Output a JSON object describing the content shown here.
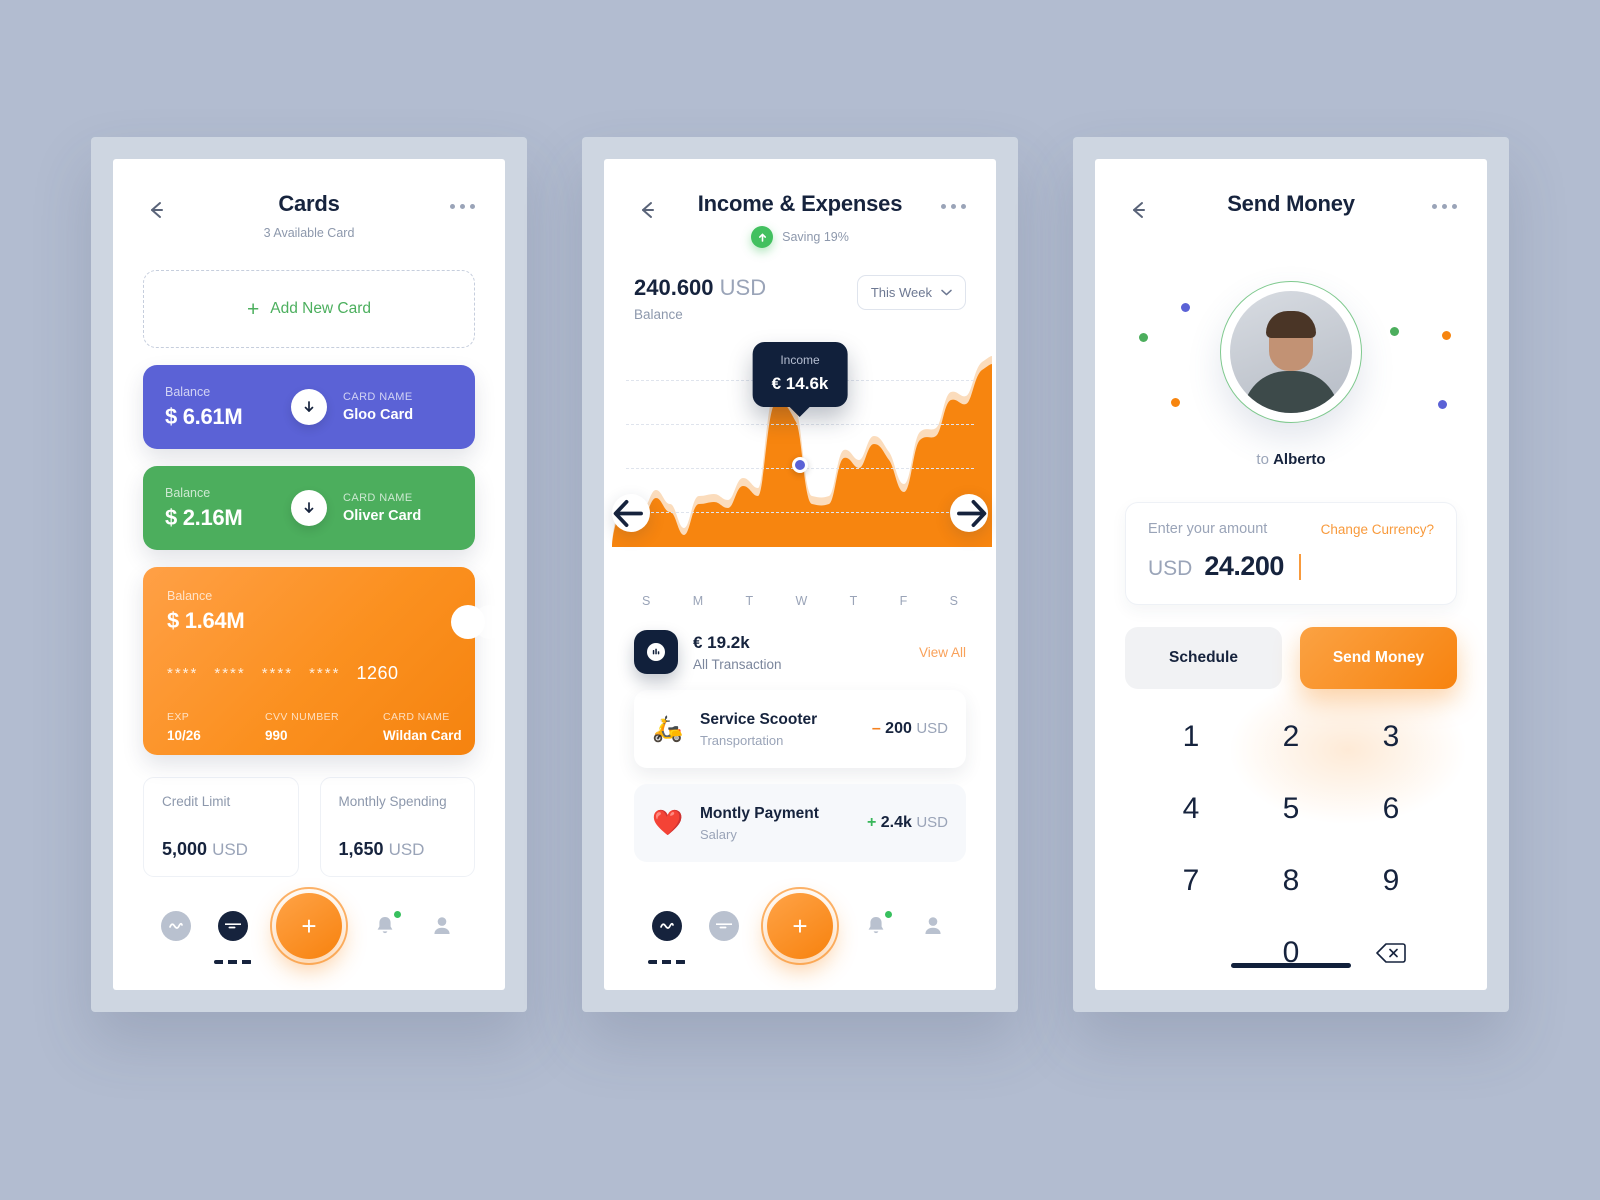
{
  "screens": {
    "cards": {
      "title": "Cards",
      "subtitle": "3 Available Card",
      "add_card_label": "Add New Card",
      "add_card_plus": "+",
      "card_list": [
        {
          "balance_label": "Balance",
          "balance": "$ 6.61M",
          "name_label": "CARD NAME",
          "name": "Gloo Card",
          "color": "#5b62d6"
        },
        {
          "balance_label": "Balance",
          "balance": "$ 2.16M",
          "name_label": "CARD NAME",
          "name": "Oliver Card",
          "color": "#4cae5d"
        }
      ],
      "featured_card": {
        "balance_label": "Balance",
        "balance": "$ 1.64M",
        "masked": [
          "****",
          "****",
          "****",
          "****"
        ],
        "last4": "1260",
        "exp_label": "EXP",
        "exp": "10/26",
        "cvv_label": "CVV NUMBER",
        "cvv": "990",
        "name_label": "CARD NAME",
        "name": "Wildan Card",
        "color": "#f7850f"
      },
      "stats": [
        {
          "title": "Credit Limit",
          "value": "5,000",
          "currency": "USD"
        },
        {
          "title": "Monthly Spending",
          "value": "1,650",
          "currency": "USD"
        }
      ]
    },
    "income": {
      "title": "Income & Expenses",
      "saving_text": "Saving 19%",
      "balance_value": "240.600",
      "balance_currency": "USD",
      "balance_caption": "Balance",
      "period": "This Week",
      "tooltip_label": "Income",
      "tooltip_value": "€ 14.6k",
      "transactions_total": "€ 19.2k",
      "transactions_caption": "All Transaction",
      "view_all": "View All",
      "rows": [
        {
          "emoji": "🛵",
          "name": "Service Scooter",
          "category": "Transportation",
          "sign": "–",
          "amount": "200",
          "currency": "USD",
          "direction": "neg"
        },
        {
          "emoji": "❤️",
          "name": "Montly Payment",
          "category": "Salary",
          "sign": "+",
          "amount": "2.4k",
          "currency": "USD",
          "direction": "pos"
        }
      ]
    },
    "send": {
      "title": "Send Money",
      "to_prefix": "to",
      "recipient": "Alberto",
      "amount_placeholder": "Enter your amount",
      "change_currency": "Change Currency?",
      "currency": "USD",
      "amount": "24.200",
      "schedule_label": "Schedule",
      "send_label": "Send Money",
      "keys": [
        "1",
        "2",
        "3",
        "4",
        "5",
        "6",
        "7",
        "8",
        "9",
        "",
        "0",
        "⌫"
      ]
    }
  },
  "chart_data": {
    "type": "area",
    "title": "Income & Expenses",
    "categories": [
      "S",
      "M",
      "T",
      "W",
      "T",
      "F",
      "S"
    ],
    "xlabel": "",
    "ylabel": "",
    "grid": true,
    "legend": false,
    "highlight": {
      "category": "T",
      "label": "Income",
      "value": "€ 14.6k",
      "numeric": 14600
    },
    "series": [
      {
        "name": "Income",
        "color": "#f7850f",
        "values": [
          0,
          4.2,
          6.1,
          5.4,
          6.5,
          3.0,
          5.1,
          5.6,
          5.2,
          7.0,
          6.2,
          14.6,
          13.0,
          5.9,
          5.2,
          8.4,
          9.2,
          8.0,
          6.3,
          9.0,
          11.5,
          12.2,
          13.4,
          16.8
        ]
      },
      {
        "name": "Expenses",
        "color": "#fbd9b6",
        "values": [
          0,
          4.9,
          6.9,
          6.2,
          7.2,
          3.7,
          5.9,
          6.4,
          6.0,
          7.8,
          7.0,
          15.4,
          13.8,
          6.6,
          5.9,
          9.2,
          10.0,
          8.8,
          7.1,
          9.8,
          12.3,
          13.0,
          14.2,
          17.6
        ]
      }
    ],
    "ylim": [
      0,
      19
    ]
  },
  "nav": {
    "items": [
      {
        "icon": "activity-icon",
        "label": "Activity"
      },
      {
        "icon": "card-icon",
        "label": "Cards"
      },
      {
        "icon": "plus-icon",
        "label": "Add"
      },
      {
        "icon": "bell-icon",
        "label": "Notifications"
      },
      {
        "icon": "person-icon",
        "label": "Profile"
      }
    ]
  },
  "colors": {
    "background": "#b2bcd0",
    "frame": "#ced6e1",
    "accent_orange": "#f7850f",
    "accent_green": "#4cae5d",
    "accent_blue": "#5b62d6",
    "ink": "#16233d"
  }
}
